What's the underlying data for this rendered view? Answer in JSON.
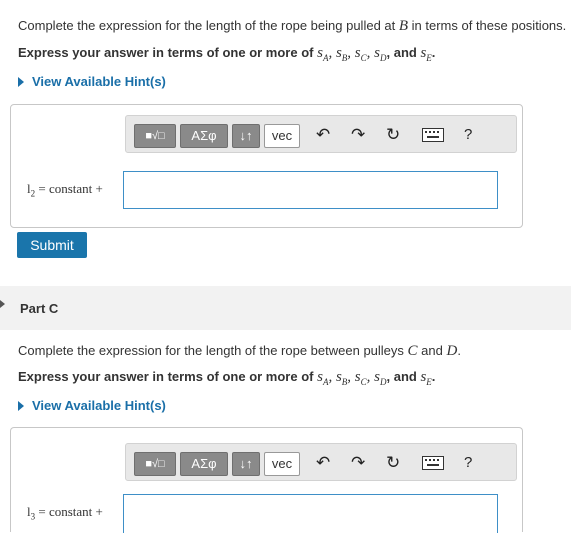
{
  "partB": {
    "question_prefix": "Complete the expression for the length of the rope being pulled at ",
    "question_var": "B",
    "question_suffix": " in terms of these positions.",
    "instruction_bold": "Express your answer in terms of one or more of ",
    "vars": [
      "sA",
      "sB",
      "sC",
      "sD",
      "sE"
    ],
    "hint_label": "View Available Hint(s)",
    "answer_label": "l2 = constant +",
    "answer_value": "",
    "submit_label": "Submit"
  },
  "partC": {
    "title": "Part C",
    "question_prefix": "Complete the expression for the length of the rope between pulleys ",
    "question_var1": "C",
    "question_mid": " and ",
    "question_var2": "D",
    "question_suffix": ".",
    "instruction_bold": "Express your answer in terms of one or more of ",
    "hint_label": "View Available Hint(s)",
    "answer_label": "l3 = constant +",
    "answer_value": ""
  },
  "toolbar": {
    "templates_icon": "templates-icon",
    "greek_label": "ΑΣφ",
    "arrows_label": "↓↑",
    "vec_label": "vec",
    "help_label": "?"
  },
  "colors": {
    "accent": "#1a75ab",
    "hint": "#1a6fa8",
    "field_border": "#3e8fc7"
  }
}
